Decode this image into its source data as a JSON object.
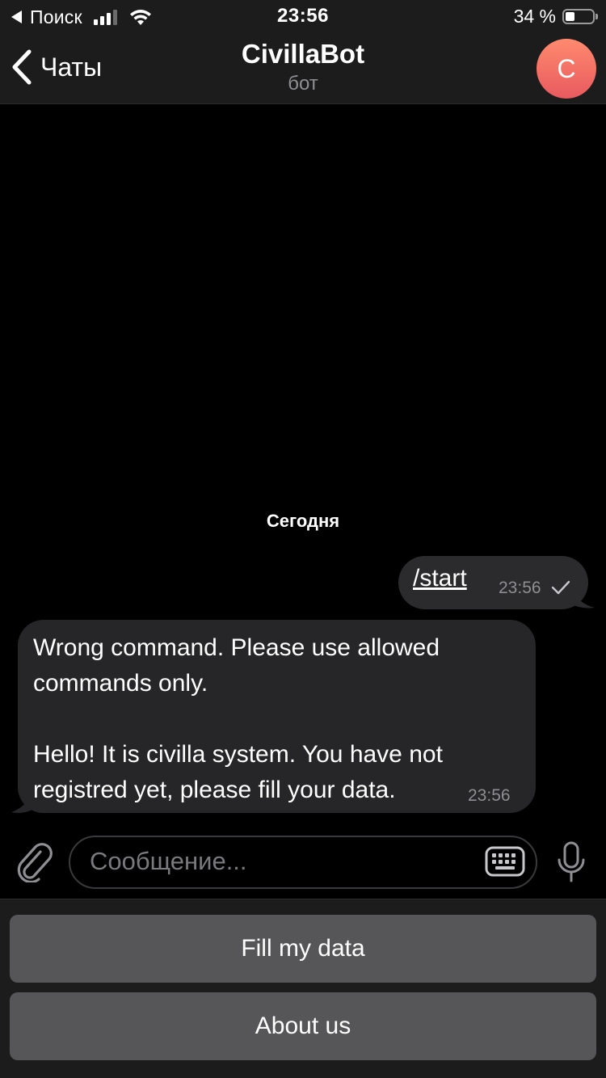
{
  "status_bar": {
    "carrier": "Поиск",
    "time": "23:56",
    "battery_percent_text": "34 %",
    "battery_level": 0.34,
    "signal_bars_filled": 3,
    "signal_bars_total": 4
  },
  "header": {
    "back_label": "Чаты",
    "title": "CivillaBot",
    "subtitle": "бот",
    "avatar_letter": "C",
    "avatar_colors": [
      "#ff8a6e",
      "#e85a5f"
    ]
  },
  "chat": {
    "date_separator": "Сегодня",
    "messages": [
      {
        "direction": "outgoing",
        "text": "/start",
        "time": "23:56",
        "status": "sent-check"
      },
      {
        "direction": "incoming",
        "text": "Wrong command. Please use allowed\ncommands only.\n\nHello! It is civilla system. You have not\nregistred yet, please fill your data.",
        "time": "23:56"
      }
    ]
  },
  "composer": {
    "placeholder": "Сообщение...",
    "attach_icon": "paperclip-icon",
    "keyboard_icon": "keyboard-icon",
    "mic_icon": "microphone-icon"
  },
  "reply_keyboard": {
    "buttons": [
      {
        "label": "Fill my data"
      },
      {
        "label": "About us"
      }
    ]
  },
  "colors": {
    "background": "#000000",
    "header_bg": "#1c1c1d",
    "bubble_outgoing": "#2b2b2d",
    "bubble_incoming": "#262628",
    "keyboard_button": "#565658",
    "secondary_text": "#8e8e93"
  }
}
